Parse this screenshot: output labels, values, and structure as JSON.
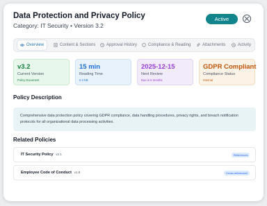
{
  "policy": {
    "title": "Data Protection and Privacy Policy",
    "subtitle": "Category: IT Security • Version 3.2",
    "status": "Active"
  },
  "tabs": [
    {
      "label": "Overview",
      "icon": "eye-icon",
      "active": true
    },
    {
      "label": "Content & Sections",
      "icon": "document-icon",
      "active": false
    },
    {
      "label": "Approval History",
      "icon": "clock-icon",
      "active": false
    },
    {
      "label": "Compliance & Reading",
      "icon": "shield-icon",
      "active": false
    },
    {
      "label": "Attachments",
      "icon": "paperclip-icon",
      "active": false
    },
    {
      "label": "Activity",
      "icon": "activity-icon",
      "active": false
    }
  ],
  "stats": [
    {
      "value": "v3.2",
      "label": "Current Version",
      "sub": "Policy Document",
      "color": "#15803d",
      "bg": "#e8f7ec",
      "border": "#c9eacf"
    },
    {
      "value": "15 min",
      "label": "Reading Time",
      "sub": "2.3 KB",
      "color": "#1d6fd6",
      "bg": "#e8f2fd",
      "border": "#cde0f7"
    },
    {
      "value": "2025-12-15",
      "label": "Next Review",
      "sub": "Due in 6 months",
      "color": "#9b3fd4",
      "bg": "#f1ebfb",
      "border": "#e1d3f4"
    },
    {
      "value": "GDPR Compliant",
      "label": "Compliance Status",
      "sub": "Internal",
      "color": "#c2570c",
      "bg": "#fdf2e6",
      "border": "#f6dcbc"
    }
  ],
  "description": {
    "heading": "Policy Description",
    "text": "Comprehensive data protection policy covering GDPR compliance, data handling procedures, privacy rights, and breach notification protocols for all organizational data processing activities."
  },
  "related": {
    "heading": "Related Policies",
    "items": [
      {
        "name": "IT Security Policy",
        "version": "v2.1",
        "relation": "References"
      },
      {
        "name": "Employee Code of Conduct",
        "version": "v1.8",
        "relation": "Cross-referenced"
      }
    ]
  },
  "colors": {
    "accent": "#12858c",
    "description_bg": "#e7f3f4"
  }
}
